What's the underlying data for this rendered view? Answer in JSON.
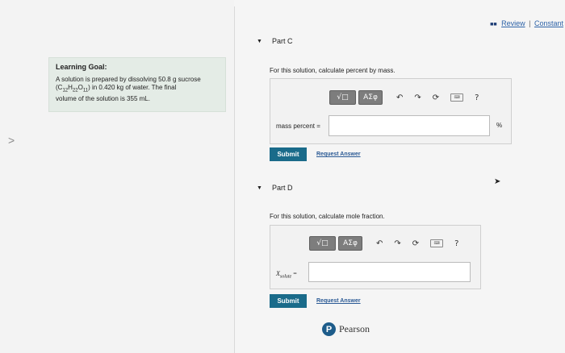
{
  "header": {
    "review_label": "Review",
    "separator": "|",
    "constants_label": "Constant",
    "icon": "review-icon"
  },
  "nav": {
    "prev_icon": "chevron-left-icon",
    "prev_glyph": ">"
  },
  "goal": {
    "title": "Learning Goal:",
    "line1": "A solution is prepared by dissolving 50.8 g sucrose",
    "line2_formula": "(C12H22O11) in 0.420 kg of water. The final",
    "line3": "volume of the solution is 355 mL."
  },
  "part_c": {
    "title": "Part C",
    "question": "For this solution, calculate percent by mass.",
    "toolbar": {
      "templates_label": "√□",
      "symbols_label": "AΣφ",
      "help": "?"
    },
    "field_label": "mass percent =",
    "field_value": "",
    "unit": "%",
    "submit": "Submit",
    "request": "Request Answer"
  },
  "part_d": {
    "title": "Part D",
    "question": "For this solution, calculate mole fraction.",
    "toolbar": {
      "templates_label": "√□",
      "symbols_label": "AΣφ",
      "help": "?"
    },
    "field_label_main": "X",
    "field_label_sub": "solute",
    "field_label_eq": "=",
    "field_value": "",
    "submit": "Submit",
    "request": "Request Answer"
  },
  "footer": {
    "brand": "Pearson",
    "logo_letter": "P"
  }
}
